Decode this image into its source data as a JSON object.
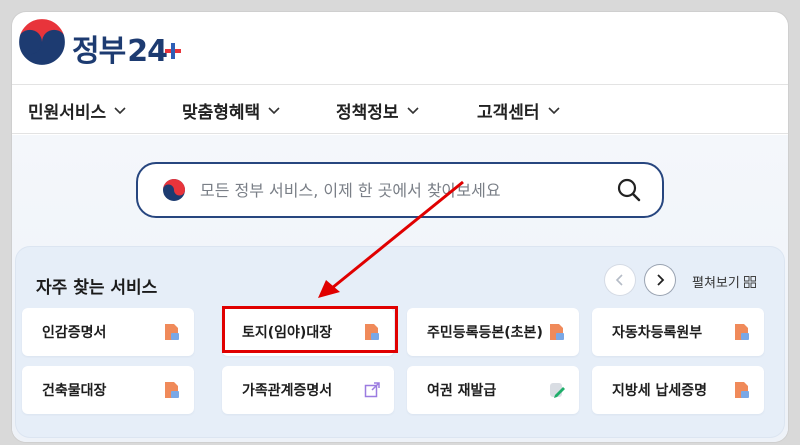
{
  "logo": {
    "text": "정부",
    "num": "24"
  },
  "nav": [
    {
      "label": "민원서비스"
    },
    {
      "label": "맞춤형혜택"
    },
    {
      "label": "정책정보"
    },
    {
      "label": "고객센터"
    }
  ],
  "search": {
    "placeholder": "모든 정부 서비스, 이제 한 곳에서 찾아보세요"
  },
  "services": {
    "title": "자주 찾는 서비스",
    "expand_label": "펼쳐보기",
    "cards": [
      {
        "label": "인감증명서",
        "icon": "pdf-doc-icon"
      },
      {
        "label": "토지(임야)대장",
        "icon": "pdf-doc-icon"
      },
      {
        "label": "주민등록등본(초본)",
        "icon": "pdf-doc-icon"
      },
      {
        "label": "자동차등록원부",
        "icon": "pdf-doc-icon"
      },
      {
        "label": "건축물대장",
        "icon": "pdf-doc-icon"
      },
      {
        "label": "가족관계증명서",
        "icon": "external-link-icon"
      },
      {
        "label": "여권 재발급",
        "icon": "edit-doc-icon"
      },
      {
        "label": "지방세 납세증명",
        "icon": "pdf-doc-icon"
      }
    ]
  },
  "colors": {
    "navy": "#1d3b71",
    "search_border": "#27467f",
    "panel_bg": "#e6eef8",
    "highlight": "#e00000",
    "doc_orange": "#f08a5a",
    "doc_blue": "#7aa8e6",
    "link_purple": "#9b7be0",
    "edit_green": "#1fae6a"
  }
}
